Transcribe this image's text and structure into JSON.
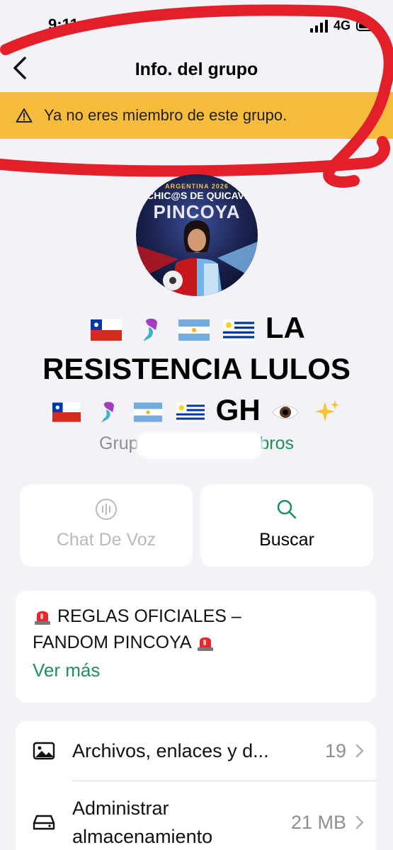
{
  "status_bar": {
    "time": "9:11",
    "network": "4G"
  },
  "nav": {
    "title": "Info. del grupo"
  },
  "banner": {
    "text": "Ya no eres miembro de este grupo.",
    "color": "#f7bc3c"
  },
  "avatar": {
    "line1": "ARGENTINA 2026",
    "line2": "CHIC@S DE QUICAVI",
    "line3": "PINCOYA"
  },
  "group": {
    "name_line1": "LA",
    "name_line2": "RESISTENCIA LULOS",
    "name_line3": "GH",
    "subtitle_start": "Grup",
    "subtitle_end": "mbros"
  },
  "actions": [
    {
      "label": "Chat De Voz",
      "icon": "voice-chat-icon",
      "enabled": false
    },
    {
      "label": "Buscar",
      "icon": "search-icon",
      "enabled": true
    }
  ],
  "description": {
    "line1": "REGLAS OFICIALES –",
    "line2": "FANDOM PINCOYA",
    "more": "Ver más"
  },
  "list": [
    {
      "label": "Archivos, enlaces y d...",
      "value": "19",
      "icon": "photo-icon"
    },
    {
      "label": "Administrar almacenamiento",
      "value": "21 MB",
      "icon": "storage-icon"
    }
  ],
  "colors": {
    "accent_green": "#1f8f5c",
    "background": "#f2f2f7",
    "annotation_red": "#e3202a"
  }
}
